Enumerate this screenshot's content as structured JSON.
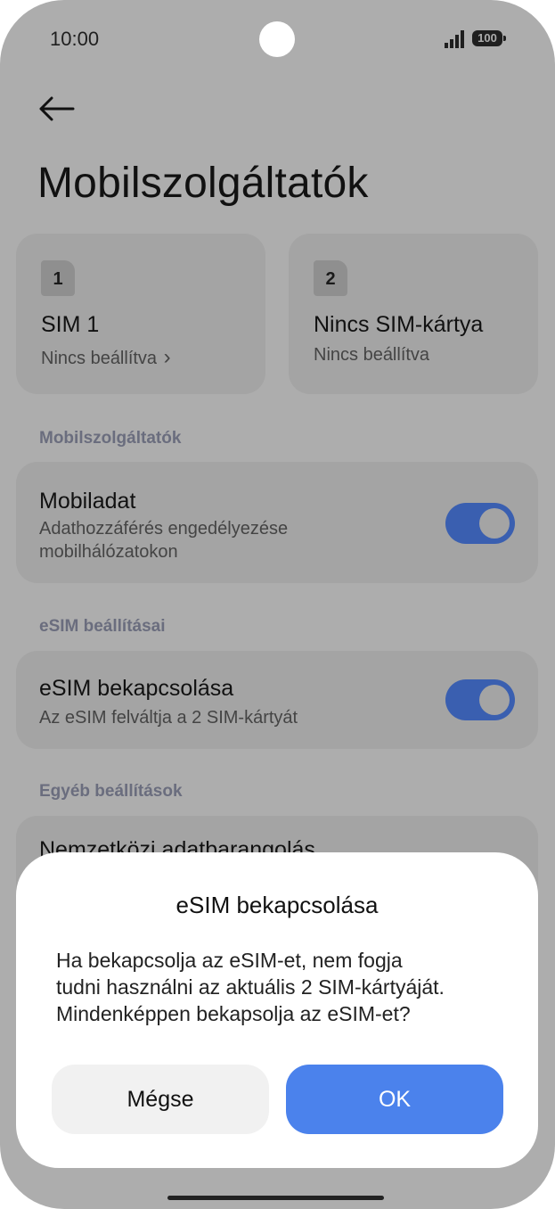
{
  "status_bar": {
    "time": "10:00",
    "battery": "100",
    "icons": [
      "signal-icon",
      "battery-icon"
    ]
  },
  "header": {
    "back_icon": "back-arrow-icon",
    "title": "Mobilszolgáltatók"
  },
  "sim_cards": [
    {
      "slot": "1",
      "name": "SIM 1",
      "status": "Nincs beállítva",
      "chevron": "›"
    },
    {
      "slot": "2",
      "name": "Nincs SIM-kártya",
      "status": "Nincs beállítva"
    }
  ],
  "sections": {
    "mobile": {
      "header": "Mobilszolgáltatók",
      "mobile_data": {
        "title": "Mobiladat",
        "subtitle": "Adathozzáférés engedélyezése\nmobilhálózatokon",
        "enabled": true
      }
    },
    "esim": {
      "header": "eSIM beállításai",
      "esim_toggle": {
        "title": "eSIM bekapcsolása",
        "subtitle": "Az eSIM felváltja a 2 SIM-kártyát",
        "enabled": true
      }
    },
    "other": {
      "header": "Egyéb beállítások",
      "partial_item_title": "Nemzetközi adatbarangolás"
    }
  },
  "dialog": {
    "title": "eSIM bekapcsolása",
    "message": "Ha bekapcsolja az eSIM-et, nem fogja\ntudni használni az aktuális 2 SIM-kártyáját.\nMindenképpen bekapsolja az eSIM-et?",
    "cancel_label": "Mégse",
    "ok_label": "OK"
  },
  "colors": {
    "scrim_background": "#adadad",
    "card_background": "#a4a4a4",
    "toggle_on": "#3a5fb0",
    "section_header": "#6a6d7e",
    "dialog_background": "#ffffff",
    "ok_button": "#4b82ec",
    "cancel_button": "#f1f1f1"
  }
}
